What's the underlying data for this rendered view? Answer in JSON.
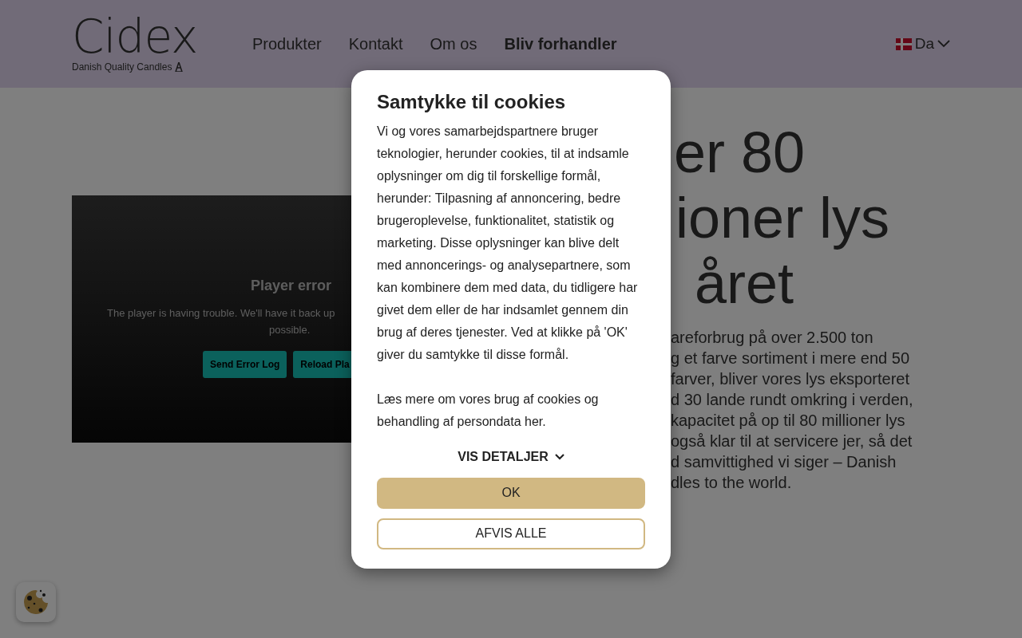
{
  "header": {
    "logo": {
      "name": "Cidex",
      "tagline": "Danish Quality Candles"
    },
    "nav": [
      {
        "label": "Produkter",
        "emphasis": false
      },
      {
        "label": "Kontakt",
        "emphasis": false
      },
      {
        "label": "Om os",
        "emphasis": false
      },
      {
        "label": "Bliv forhandler",
        "emphasis": true
      }
    ],
    "language": {
      "label": "Da"
    }
  },
  "video_player": {
    "title": "Player error",
    "message_lines": [
      "The player is having trouble. We'll have it back up",
      "possible."
    ],
    "buttons": [
      "Send Error Log",
      "Reload Pla"
    ]
  },
  "hero": {
    "heading_lines": [
      "er 80",
      "ioner lys",
      "året"
    ],
    "text_lines": [
      "areforbrug på over 2.500 ton",
      "g et farve sortiment i mere end 50",
      "farver, bliver vores lys eksporteret",
      "d 30 lande rundt omkring i verden,",
      "kapacitet på op til 80 millioner lys",
      "også klar til at servicere jer, så det",
      "d samvittighed vi siger – Danish",
      "dles to the world."
    ]
  },
  "cookie_dialog": {
    "title": "Samtykke til cookies",
    "paragraphs": [
      "Vi og vores samarbejdspartnere bruger teknologier, herunder cookies, til at indsamle oplysninger om dig til forskellige formål, herunder: Tilpasning af annoncering, bedre brugeroplevelse, funktionalitet, statistik og marketing. Disse oplysninger kan blive delt med annoncerings- og analysepartnere, som kan kombinere dem med data, du tidligere har givet dem eller de har indsamlet gennem din brug af deres tjenester. Ved at klikke på 'OK' giver du samtykke til disse formål.",
      "Læs mere om vores brug af cookies og behandling af persondata her."
    ],
    "details_toggle": {
      "label": "VIS DETALJER",
      "expanded": false
    },
    "buttons": [
      {
        "label": "OK",
        "kind": "primary"
      },
      {
        "label": "AFVIS ALLE",
        "kind": "outline"
      }
    ]
  }
}
